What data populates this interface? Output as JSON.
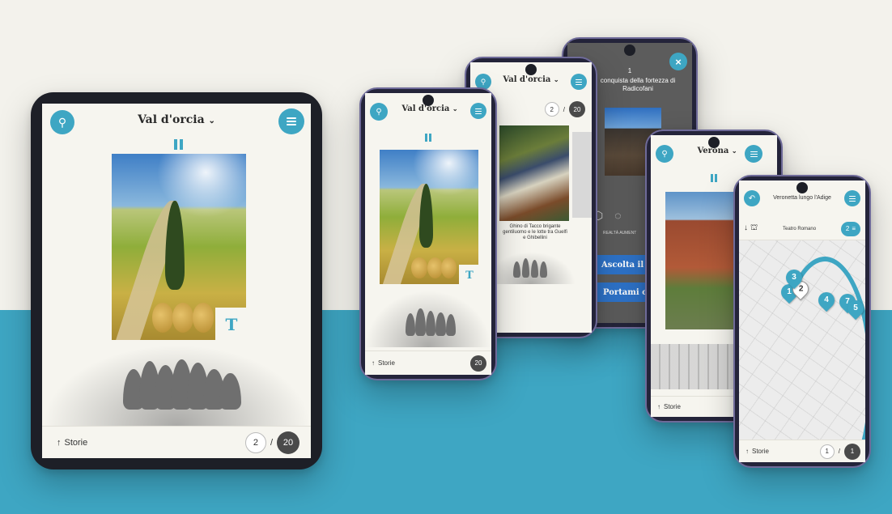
{
  "tablet": {
    "title": "Val d'orcia",
    "badge": "T",
    "stories_label": "Storie",
    "page_current": "2",
    "page_sep": "/",
    "page_total": "20"
  },
  "phone1": {
    "title": "Val d'orcia",
    "badge": "T",
    "stories_label": "Storie",
    "page_total": "20"
  },
  "phone2": {
    "title": "Val d'orcia",
    "page_current": "2",
    "page_sep": "/",
    "page_total": "20",
    "caption": "Ghino di Tacco brigante gentiluomo e le lotte tra Guelfi e Ghibellini"
  },
  "phone3": {
    "number": "1",
    "heading": "conquista della fortezza di Radicofani",
    "close": "×",
    "ar_label": "REALTÀ AUMENT",
    "listen_button": "Ascolta il cap",
    "take_me_button": "Portami c"
  },
  "phone4": {
    "title": "Verona",
    "stories_label": "Storie"
  },
  "phone5": {
    "title": "Veronetta lungo l'Adige",
    "place": "Teatro Romano",
    "chip_count": "2",
    "stories_label": "Storie",
    "page_current": "1",
    "page_sep": "/",
    "page_total": "1",
    "pins": [
      "1",
      "2",
      "3",
      "4",
      "7",
      "5"
    ]
  },
  "colors": {
    "accent": "#3ea6c3",
    "background": "#f3f2ec",
    "dark": "#4a4a4a"
  },
  "icons": {
    "logo": "italy-map-icon",
    "menu": "menu-icon",
    "pause": "pause-icon",
    "stories": "arrow-up-icon",
    "back": "back-arrow-icon",
    "close": "close-icon"
  }
}
